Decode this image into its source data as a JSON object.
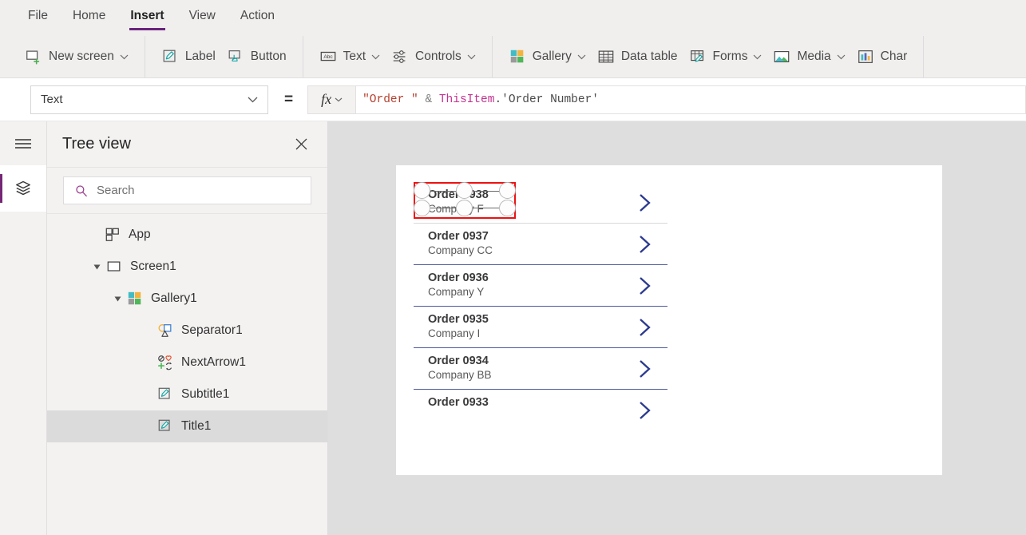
{
  "menubar": {
    "items": [
      {
        "label": "File",
        "active": false
      },
      {
        "label": "Home",
        "active": false
      },
      {
        "label": "Insert",
        "active": true
      },
      {
        "label": "View",
        "active": false
      },
      {
        "label": "Action",
        "active": false
      }
    ]
  },
  "ribbon": {
    "groups": [
      {
        "items": [
          {
            "label": "New screen",
            "icon": "new-screen-icon",
            "caret": true
          }
        ]
      },
      {
        "items": [
          {
            "label": "Label",
            "icon": "label-icon",
            "caret": false
          },
          {
            "label": "Button",
            "icon": "button-icon",
            "caret": false
          }
        ]
      },
      {
        "items": [
          {
            "label": "Text",
            "icon": "text-abc-icon",
            "caret": true
          },
          {
            "label": "Controls",
            "icon": "controls-sliders-icon",
            "caret": true
          }
        ]
      },
      {
        "items": [
          {
            "label": "Gallery",
            "icon": "gallery-icon",
            "caret": true
          },
          {
            "label": "Data table",
            "icon": "data-table-icon",
            "caret": false
          },
          {
            "label": "Forms",
            "icon": "forms-icon",
            "caret": true
          },
          {
            "label": "Media",
            "icon": "media-image-icon",
            "caret": true
          },
          {
            "label": "Char",
            "icon": "charts-icon",
            "caret": false
          }
        ]
      }
    ]
  },
  "formula_bar": {
    "property_selected": "Text",
    "equals": "=",
    "fx_label": "fx",
    "formula_tokens": [
      {
        "text": "\"Order \"",
        "kind": "string"
      },
      {
        "text": " ",
        "kind": "space"
      },
      {
        "text": "&",
        "kind": "operator"
      },
      {
        "text": " ",
        "kind": "space"
      },
      {
        "text": "ThisItem",
        "kind": "object"
      },
      {
        "text": ".",
        "kind": "punct"
      },
      {
        "text": "'Order Number'",
        "kind": "field"
      }
    ],
    "formula_plain": "\"Order \" & ThisItem.'Order Number'"
  },
  "rail": {
    "hamburger": "hamburger-menu-icon",
    "buttons": [
      {
        "icon": "tree-view-layers-icon",
        "active": true
      }
    ]
  },
  "tree_panel": {
    "title": "Tree view",
    "close_icon": "close-icon",
    "search_placeholder": "Search",
    "search_value": "",
    "search_icon": "search-icon",
    "items": [
      {
        "label": "App",
        "icon": "app-icon",
        "indent": 0,
        "twisty": "none",
        "selected": false
      },
      {
        "label": "Screen1",
        "icon": "screen-icon",
        "indent": 0,
        "twisty": "expanded",
        "selected": false
      },
      {
        "label": "Gallery1",
        "icon": "gallery-icon",
        "indent": 1,
        "twisty": "expanded",
        "selected": false
      },
      {
        "label": "Separator1",
        "icon": "shapes-icon",
        "indent": 2,
        "twisty": "none",
        "selected": false
      },
      {
        "label": "NextArrow1",
        "icon": "icons-icon",
        "indent": 2,
        "twisty": "none",
        "selected": false
      },
      {
        "label": "Subtitle1",
        "icon": "label-icon",
        "indent": 2,
        "twisty": "none",
        "selected": false
      },
      {
        "label": "Title1",
        "icon": "label-icon",
        "indent": 2,
        "twisty": "none",
        "selected": true
      }
    ]
  },
  "canvas": {
    "gallery": {
      "name": "Gallery1",
      "chevron_icon": "chevron-right-icon",
      "items": [
        {
          "title": "Order 0938",
          "subtitle": "Company F",
          "selected": true
        },
        {
          "title": "Order 0937",
          "subtitle": "Company CC",
          "selected": false
        },
        {
          "title": "Order 0936",
          "subtitle": "Company Y",
          "selected": false
        },
        {
          "title": "Order 0935",
          "subtitle": "Company I",
          "selected": false
        },
        {
          "title": "Order 0934",
          "subtitle": "Company BB",
          "selected": false
        },
        {
          "title": "Order 0933",
          "subtitle": "",
          "selected": false
        }
      ]
    },
    "selection": {
      "target": "Title1",
      "color": "#ee1111",
      "handle_count": 6
    }
  },
  "colors": {
    "accent_purple": "#742774",
    "tab_underline": "#69247c",
    "chevron_blue": "#2b3a8f",
    "separator_blue": "#4d5a9b",
    "selection_red": "#ee1111",
    "canvas_gray": "#dedede",
    "panel_gray": "#f3f2f1",
    "ribbon_gray": "#f0efee"
  }
}
